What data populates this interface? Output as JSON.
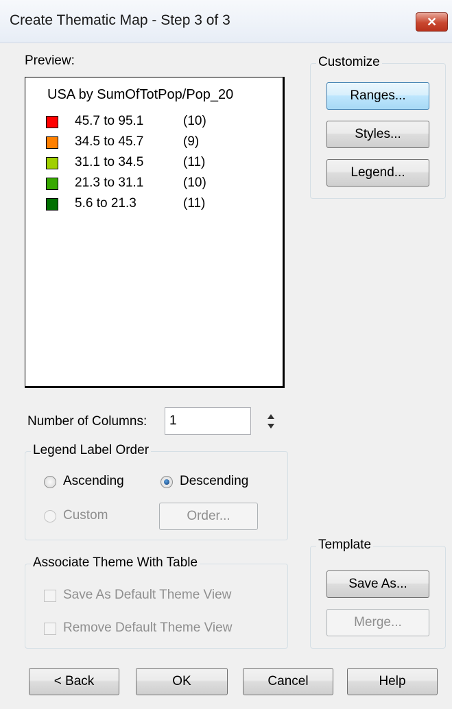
{
  "window": {
    "title": "Create Thematic Map - Step 3 of 3",
    "close_symbol": "✕"
  },
  "preview": {
    "label": "Preview:",
    "map_title": "USA by SumOfTotPop/Pop_20",
    "legend": [
      {
        "range": "45.7 to 95.1",
        "count": "(10)",
        "color": "#ff0000"
      },
      {
        "range": "34.5 to 45.7",
        "count": "(9)",
        "color": "#ff8000"
      },
      {
        "range": "31.1 to 34.5",
        "count": "(11)",
        "color": "#a0d000"
      },
      {
        "range": "21.3 to 31.1",
        "count": "(10)",
        "color": "#38a800"
      },
      {
        "range": "5.6 to 21.3",
        "count": "(11)",
        "color": "#007000"
      }
    ]
  },
  "customize": {
    "title": "Customize",
    "ranges_button": "Ranges...",
    "styles_button": "Styles...",
    "legend_button": "Legend..."
  },
  "columns": {
    "label": "Number of Columns:",
    "value": "1"
  },
  "legend_order": {
    "title": "Legend Label Order",
    "ascending": "Ascending",
    "descending": "Descending",
    "custom": "Custom",
    "order_button": "Order...",
    "selected": "Descending"
  },
  "associate": {
    "title": "Associate Theme With Table",
    "save_default": "Save As Default Theme View",
    "remove_default": "Remove Default Theme View"
  },
  "template": {
    "title": "Template",
    "save_as_button": "Save As...",
    "merge_button": "Merge..."
  },
  "footer": {
    "back": "< Back",
    "ok": "OK",
    "cancel": "Cancel",
    "help": "Help"
  }
}
